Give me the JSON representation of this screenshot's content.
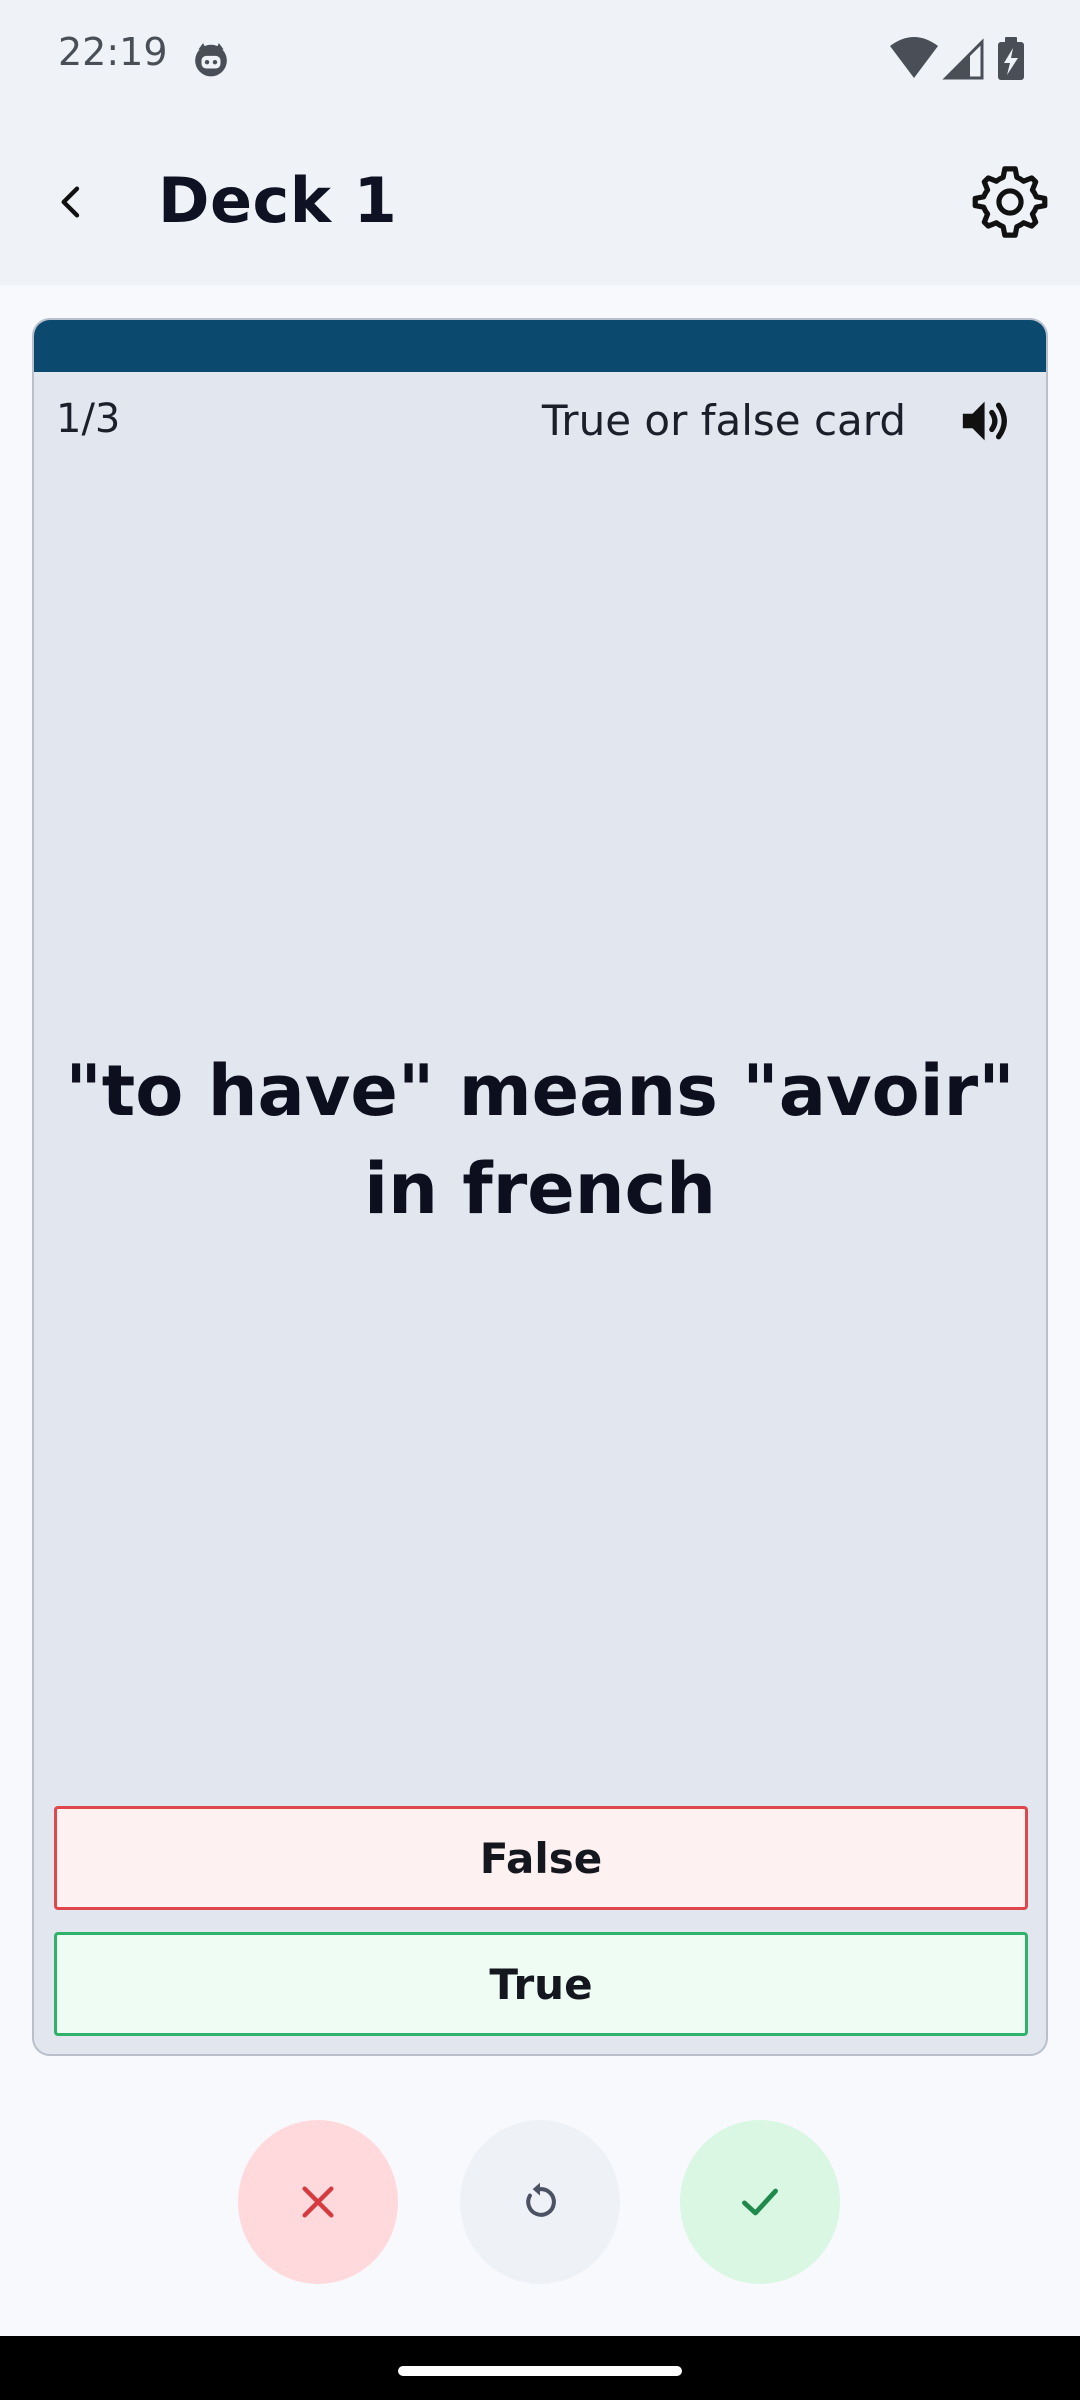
{
  "status_bar": {
    "time": "22:19"
  },
  "app_bar": {
    "title": "Deck 1"
  },
  "card": {
    "counter": "1/3",
    "type_label": "True or false card",
    "question": "\"to have\" means \"avoir\" in french",
    "header_color": "#0b4a6e",
    "answers": [
      {
        "label": "False",
        "border_color": "#e0474c"
      },
      {
        "label": "True",
        "border_color": "#2fb36a"
      }
    ]
  },
  "icons": {
    "back": "back-arrow-icon",
    "settings": "gear-icon",
    "speaker": "speaker-icon",
    "wrong": "close-icon",
    "reset": "undo-icon",
    "right": "check-icon"
  }
}
